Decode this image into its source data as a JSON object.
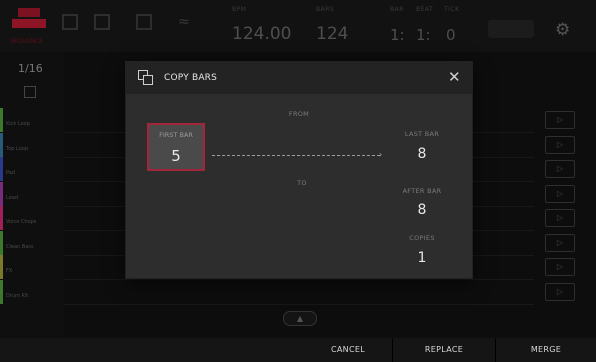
{
  "topbar": {
    "logo_label": "SEQUENCE",
    "bpm_label": "BPM",
    "bpm_value": "124.00",
    "bars_label": "BARS",
    "bars_value": "124",
    "pos_labels": [
      "BAR",
      "BEAT",
      "TICK"
    ],
    "pos_values": [
      "1:",
      "1:",
      "0"
    ]
  },
  "left": {
    "grid_value": "1/16"
  },
  "tracks": [
    {
      "name": "Kick Loop",
      "color": "#3b7a2a"
    },
    {
      "name": "Top Loop",
      "color": "#2a5a7a"
    },
    {
      "name": "Pad",
      "color": "#2a3a8a"
    },
    {
      "name": "Lead",
      "color": "#7a2a7a"
    },
    {
      "name": "Voice Chops",
      "color": "#a0205a"
    },
    {
      "name": "Clean Bass",
      "color": "#3b7a2a"
    },
    {
      "name": "FX",
      "color": "#7a7a2a"
    },
    {
      "name": "Drum Kit",
      "color": "#3b7a2a"
    }
  ],
  "dialog": {
    "title": "COPY BARS",
    "from_label": "FROM",
    "first_bar_label": "FIRST BAR",
    "first_bar_value": "5",
    "last_bar_label": "LAST BAR",
    "last_bar_value": "8",
    "to_label": "TO",
    "after_bar_label": "AFTER BAR",
    "after_bar_value": "8",
    "copies_label": "COPIES",
    "copies_value": "1",
    "accent_color": "#a3253a"
  },
  "bottom": {
    "cancel_label": "CANCEL",
    "replace_label": "REPLACE",
    "merge_label": "MERGE"
  },
  "icons": {
    "dialog_icon": "copy-icon",
    "close_icon": "close-icon",
    "play_icon": "play-icon",
    "scroll_icon": "chevron-up-icon",
    "gear_icon": "gear-icon"
  }
}
